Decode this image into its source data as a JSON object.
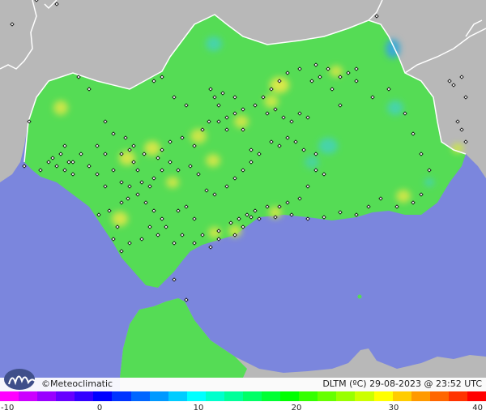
{
  "credit": {
    "text": "Meteoclimatic",
    "copyright_symbol": "©"
  },
  "info": {
    "variable": "DLTM (ºC)",
    "date": "29-08-2023",
    "time": "@ 23:52 UTC"
  },
  "scale": {
    "labels": [
      "-10",
      "0",
      "10",
      "20",
      "30",
      "40"
    ],
    "min": -10,
    "max": 40,
    "colors": [
      "#ff00ff",
      "#cc00ff",
      "#9900ff",
      "#6600ff",
      "#3300ff",
      "#0000ff",
      "#0033ff",
      "#0066ff",
      "#0099ff",
      "#00ccff",
      "#00ffff",
      "#00ffcc",
      "#00ff99",
      "#00ff66",
      "#00ff33",
      "#00ff00",
      "#33ff00",
      "#66ff00",
      "#99ff00",
      "#ccff00",
      "#ffff00",
      "#ffcc00",
      "#ff9900",
      "#ff6600",
      "#ff3300",
      "#ff0000"
    ]
  },
  "map_colors": {
    "sea": "#7b86dd",
    "land_outside": "#b8b8b8",
    "land_main": "#55dc55",
    "border": "#ffffff",
    "station_marker": "#000000"
  },
  "icons": {
    "logo": "meteoclimatic-logo-icon"
  }
}
